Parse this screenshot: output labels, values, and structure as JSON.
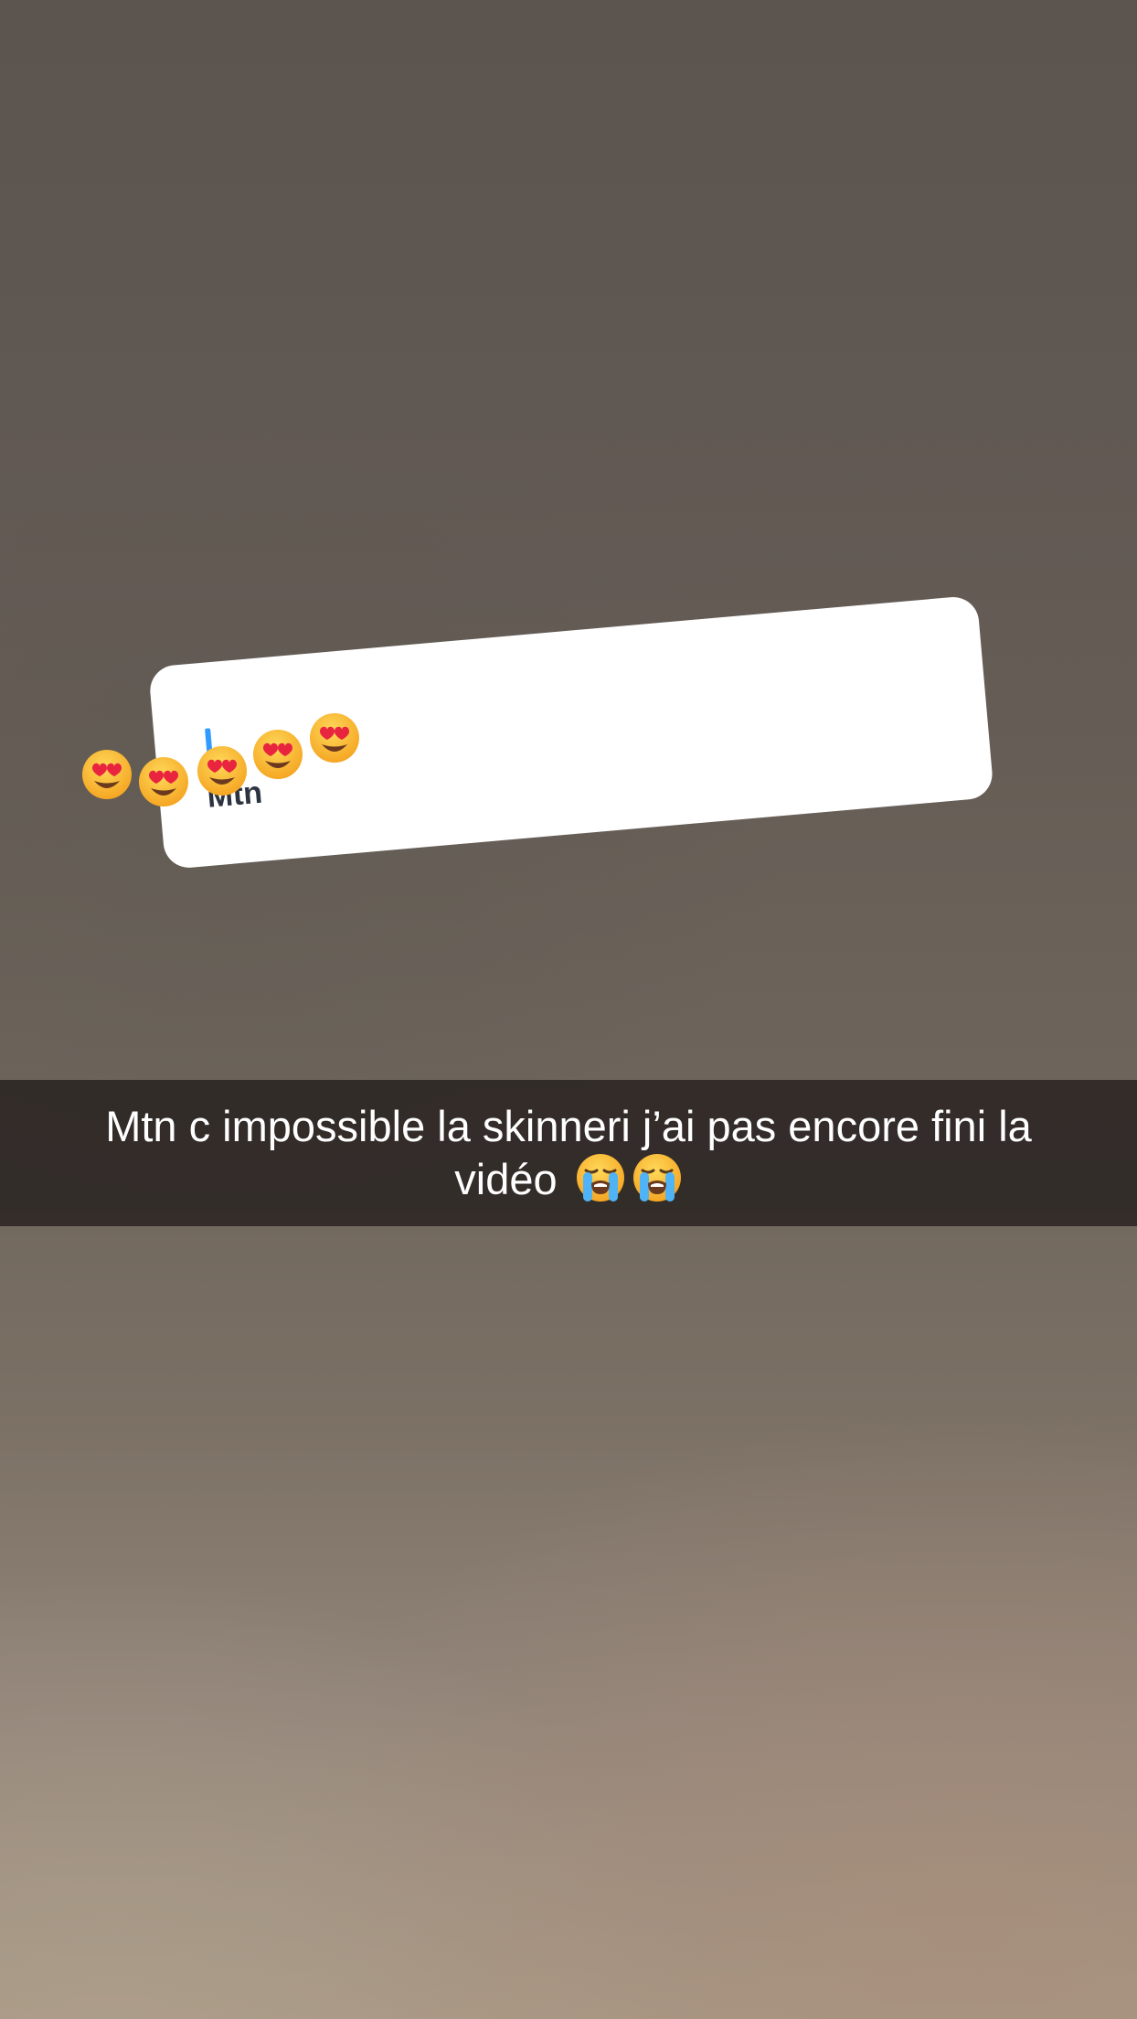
{
  "sticker": {
    "author": "Mtn",
    "emojis": [
      "heart-eyes-emoji",
      "heart-eyes-emoji",
      "heart-eyes-emoji",
      "heart-eyes-emoji",
      "heart-eyes-emoji"
    ],
    "accent_color": "#2f9bff"
  },
  "caption": {
    "line1": "Mtn c impossible la skinneri j’ai pas encore fini la",
    "line2": "vidéo",
    "emojis": [
      "loudly-crying-emoji",
      "loudly-crying-emoji"
    ]
  }
}
